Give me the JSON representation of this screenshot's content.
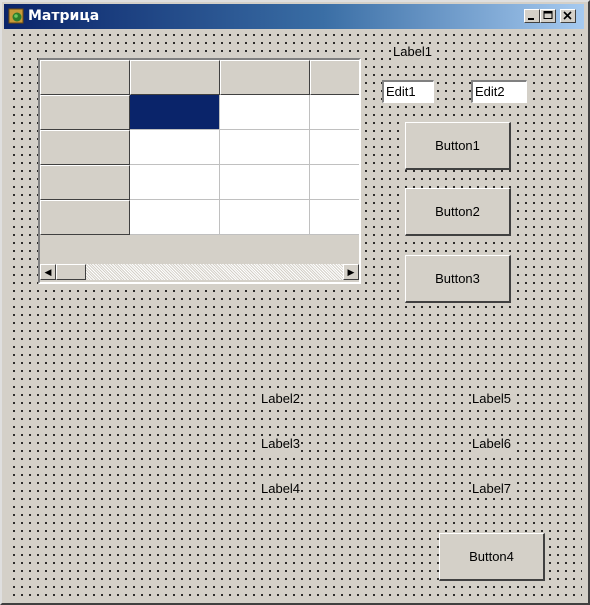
{
  "window": {
    "title": "Матрица",
    "controls": [
      "minimize-icon",
      "maximize-icon",
      "close-icon"
    ]
  },
  "grid": {
    "fixed_rows": 1,
    "fixed_cols": 1,
    "rows": 5,
    "cols": 4,
    "selected_cell": {
      "row": 1,
      "col": 1
    },
    "cells": [
      [
        "",
        "",
        "",
        ""
      ],
      [
        "",
        "",
        "",
        ""
      ],
      [
        "",
        "",
        "",
        ""
      ],
      [
        "",
        "",
        "",
        ""
      ],
      [
        "",
        "",
        "",
        ""
      ]
    ]
  },
  "labels": {
    "label1": "Label1",
    "label2": "Label2",
    "label3": "Label3",
    "label4": "Label4",
    "label5": "Label5",
    "label6": "Label6",
    "label7": "Label7"
  },
  "edits": {
    "edit1": "Edit1",
    "edit2": "Edit2"
  },
  "buttons": {
    "button1": "Button1",
    "button2": "Button2",
    "button3": "Button3",
    "button4": "Button4"
  },
  "colors": {
    "face": "#d4d0c8",
    "title_start": "#0a246a",
    "title_end": "#a6caf0",
    "selection": "#0a246a"
  }
}
